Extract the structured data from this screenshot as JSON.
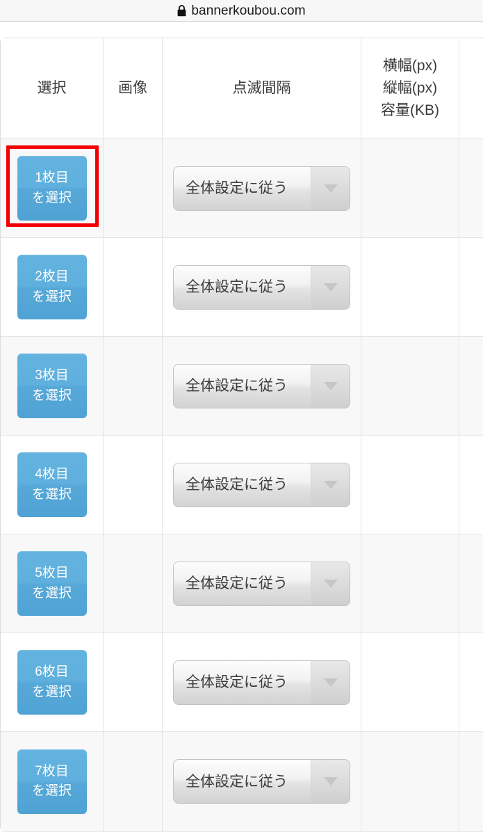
{
  "browser": {
    "lock_icon": "lock-icon",
    "url": "bannerkoubou.com"
  },
  "table": {
    "headers": [
      {
        "id": "select",
        "label": "選択"
      },
      {
        "id": "image",
        "label": "画像"
      },
      {
        "id": "blink_interval",
        "label": "点滅間隔"
      },
      {
        "id": "dimensions",
        "lines": [
          "横幅(px)",
          "縦幅(px)",
          "容量(KB)"
        ]
      },
      {
        "id": "extra",
        "label": ""
      }
    ],
    "select_option_label": "全体設定に従う",
    "dropdown_arrow_icon": "chevron-down-icon",
    "rows": [
      {
        "index": 1,
        "button_line1": "1枚目",
        "button_line2": "を選択",
        "blink_value": "全体設定に従う",
        "image": "",
        "dimensions": "",
        "highlighted": true,
        "stripe": "odd"
      },
      {
        "index": 2,
        "button_line1": "2枚目",
        "button_line2": "を選択",
        "blink_value": "全体設定に従う",
        "image": "",
        "dimensions": "",
        "highlighted": false,
        "stripe": "even"
      },
      {
        "index": 3,
        "button_line1": "3枚目",
        "button_line2": "を選択",
        "blink_value": "全体設定に従う",
        "image": "",
        "dimensions": "",
        "highlighted": false,
        "stripe": "odd"
      },
      {
        "index": 4,
        "button_line1": "4枚目",
        "button_line2": "を選択",
        "blink_value": "全体設定に従う",
        "image": "",
        "dimensions": "",
        "highlighted": false,
        "stripe": "even"
      },
      {
        "index": 5,
        "button_line1": "5枚目",
        "button_line2": "を選択",
        "blink_value": "全体設定に従う",
        "image": "",
        "dimensions": "",
        "highlighted": false,
        "stripe": "odd"
      },
      {
        "index": 6,
        "button_line1": "6枚目",
        "button_line2": "を選択",
        "blink_value": "全体設定に従う",
        "image": "",
        "dimensions": "",
        "highlighted": false,
        "stripe": "even"
      },
      {
        "index": 7,
        "button_line1": "7枚目",
        "button_line2": "を選択",
        "blink_value": "全体設定に従う",
        "image": "",
        "dimensions": "",
        "highlighted": false,
        "stripe": "odd"
      }
    ]
  },
  "colors": {
    "button_blue": "#5aabd9",
    "highlight_red": "#f40000",
    "row_stripe": "#f8f8f8",
    "border_gray": "#e4e4e4",
    "text_dark": "#3a3a3a"
  }
}
